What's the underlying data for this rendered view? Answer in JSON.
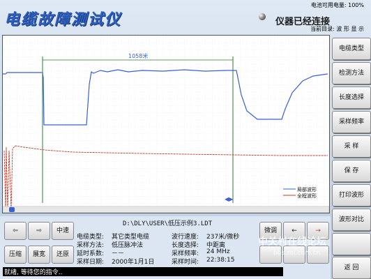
{
  "header": {
    "title": "电缆故障测试仪",
    "status": "仪器已经连接",
    "battery": "电池可用电量: 100%",
    "current_dir": "当前目录: 波 形 显 示"
  },
  "plot": {
    "distance_label": "1058米",
    "legend": [
      "局部波形",
      "全程波形"
    ]
  },
  "right_menu": [
    "电缆类型",
    "检测方法",
    "长度选择",
    "采样频率",
    "采 样",
    "保 存",
    "打印波形",
    "波形对比",
    "",
    "返 回"
  ],
  "nav": {
    "zoom_in": "中速",
    "compress": "压缩",
    "expand": "展宽",
    "restore": "还原",
    "fine": "微调"
  },
  "file": {
    "path": "D:\\DLY\\USER\\低压示例3.LDT"
  },
  "info": {
    "cable_type_label": "电缆类型:",
    "cable_type": "其它类型电缆",
    "method_label": "采样方法:",
    "method": "低压脉冲法",
    "delay_label": "延时系数:",
    "delay": "－－",
    "date_label": "采样日期:",
    "date": "2000年1月1日",
    "speed_label": "波行速度:",
    "speed": "237米/微秒",
    "length_label": "长度选择:",
    "length": "中距离",
    "freq_label": "采样频率:",
    "freq": "24 MHz",
    "time_label": "采样时间:",
    "time": "22:38:15"
  },
  "status_bar": "就绪, 等待您的指令..",
  "watermark": {
    "text": "中关村在线论坛",
    "url": "bbs.zol.com.cn"
  },
  "colors": {
    "wave_local": "#3a5fd0",
    "wave_full": "#c0392b",
    "cursor": "#2e7d32"
  }
}
